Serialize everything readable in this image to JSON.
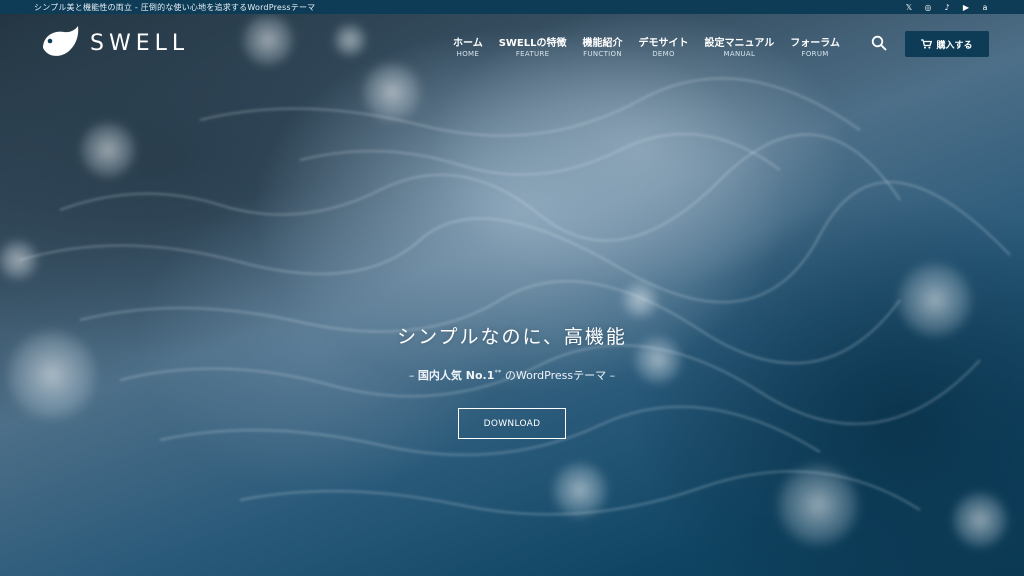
{
  "topbar": {
    "tagline": "シンプル美と機能性の両立 - 圧倒的な使い心地を追求するWordPressテーマ",
    "social": [
      {
        "icon": "x-icon",
        "glyph": "𝕏"
      },
      {
        "icon": "instagram-icon",
        "glyph": "◎"
      },
      {
        "icon": "tiktok-icon",
        "glyph": "♪"
      },
      {
        "icon": "youtube-icon",
        "glyph": "▶"
      },
      {
        "icon": "amazon-icon",
        "glyph": "a"
      }
    ]
  },
  "header": {
    "logo_text": "SWELL",
    "nav": [
      {
        "ja": "ホーム",
        "en": "HOME"
      },
      {
        "ja": "SWELLの特徴",
        "en": "FEATURE"
      },
      {
        "ja": "機能紹介",
        "en": "FUNCTION"
      },
      {
        "ja": "デモサイト",
        "en": "DEMO"
      },
      {
        "ja": "設定マニュアル",
        "en": "MANUAL"
      },
      {
        "ja": "フォーラム",
        "en": "FORUM"
      }
    ],
    "buy_label": "購入する"
  },
  "hero": {
    "title": "シンプルなのに、高機能",
    "sub_prefix": "– ",
    "sub_bold": "国内人気 No.1",
    "sub_sup": "**",
    "sub_suffix": " のWordPressテーマ –",
    "download_label": "DOWNLOAD"
  },
  "colors": {
    "topbar_bg": "#0e3c57",
    "buy_bg": "#0e3c57"
  }
}
